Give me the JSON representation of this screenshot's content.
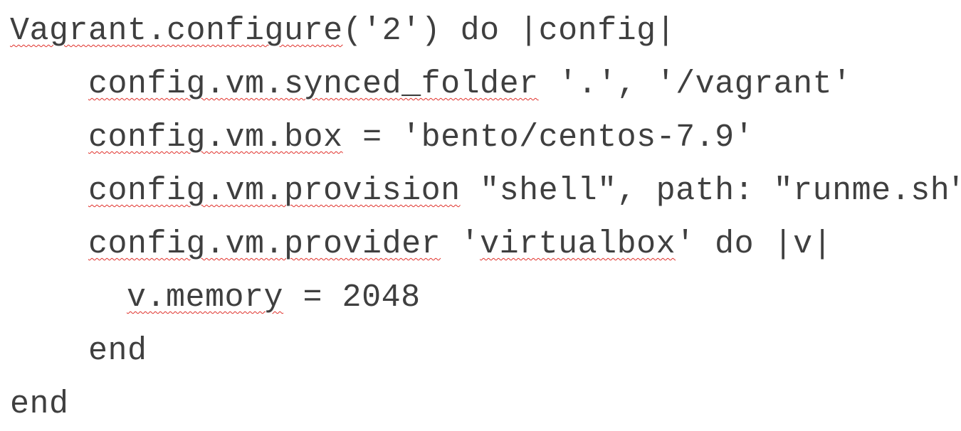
{
  "document": {
    "lines": [
      {
        "segments": [
          "Vagrant.configure",
          "('2') do |config|"
        ]
      },
      {
        "segments": [
          "config.vm.synced_folder",
          " '.', '/vagrant'"
        ]
      },
      {
        "segments": [
          "config.vm.box",
          " = 'bento/centos-7.9'"
        ]
      },
      {
        "segments": [
          "config.vm.provision",
          " \"shell\", path: \"runme.sh\""
        ]
      },
      {
        "segments": [
          "config.vm.provider",
          " '",
          "virtualbox",
          "' do |v|"
        ]
      },
      {
        "segments": [
          "v.memory",
          " = 2048"
        ]
      },
      {
        "segments": [
          "end"
        ]
      },
      {
        "segments": [
          "end"
        ]
      }
    ]
  },
  "colors": {
    "text": "#3f3f3f",
    "spellcheck_underline": "#e0302a",
    "background": "#ffffff"
  }
}
